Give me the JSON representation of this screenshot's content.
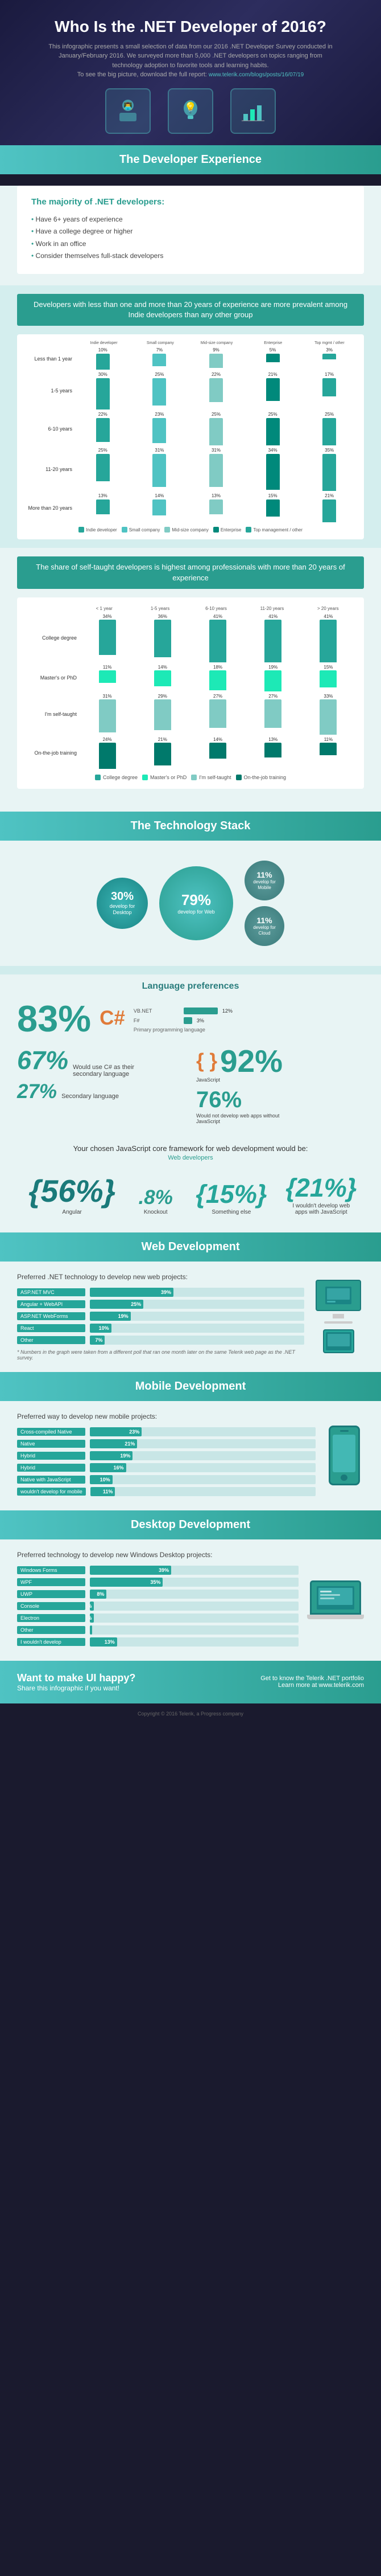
{
  "hero": {
    "title": "Who Is the .NET Developer of 2016?",
    "subtitle": "This infographic presents a small selection of data from our 2016 .NET Developer Survey conducted in January/February 2016. We surveyed more than 5,000 .NET developers on topics ranging from technology adoption to favorite tools and learning habits.",
    "link_text": "www.telerik.com/blogs/posts/16/07/19",
    "link_label": "To see the big picture, download the full report:"
  },
  "sections": {
    "developer_experience": {
      "header": "The Developer Experience",
      "majority_title": "The majority of .NET developers:",
      "majority_items": [
        "Have 6+ years of experience",
        "Have a college degree or higher",
        "Work in an office",
        "Consider themselves full-stack developers"
      ],
      "exp_chart_title": "Developers with less than one and more than 20 years of experience are more prevalent among Indie developers than any other group",
      "experience_rows": [
        {
          "label": "Less than 1 year",
          "values": [
            10,
            7,
            9,
            5,
            3
          ],
          "colors": [
            "#26a69a",
            "#1de9b6",
            "#80cbc4",
            "#4db6ac",
            "#00897b"
          ]
        },
        {
          "label": "1-5 years",
          "values": [
            30,
            25,
            22,
            21,
            17
          ],
          "colors": [
            "#26a69a",
            "#1de9b6",
            "#80cbc4",
            "#4db6ac",
            "#00897b"
          ]
        },
        {
          "label": "6-10 years",
          "values": [
            22,
            23,
            25,
            25,
            25
          ],
          "colors": [
            "#26a69a",
            "#1de9b6",
            "#80cbc4",
            "#4db6ac",
            "#00897b"
          ]
        },
        {
          "label": "11-20 years",
          "values": [
            25,
            31,
            31,
            34,
            35
          ],
          "colors": [
            "#26a69a",
            "#1de9b6",
            "#80cbc4",
            "#4db6ac",
            "#00897b"
          ]
        },
        {
          "label": "More than 20 years",
          "values": [
            13,
            14,
            13,
            15,
            21
          ],
          "colors": [
            "#26a69a",
            "#1de9b6",
            "#80cbc4",
            "#4db6ac",
            "#00897b"
          ]
        }
      ],
      "exp_col_headers": [
        "Indie developer",
        "Small company",
        "Mid-size company",
        "Enterprise",
        "Top management / other"
      ],
      "self_taught_title": "The share of self-taught developers is highest among professionals with more than 20 years of experience",
      "st_labels": [
        "College degree",
        "Master's or PhD",
        "I'm self-taught",
        "On-the-job training"
      ],
      "st_col_headers": [
        "< 1 year",
        "1-5 years",
        "6-10 years",
        "11-20 years",
        "> 20 years"
      ],
      "st_colors": [
        "#26a69a",
        "#1de9b6",
        "#80cbc4",
        "#00796b"
      ],
      "st_data": [
        [
          34,
          36,
          41,
          41,
          41
        ],
        [
          11,
          14,
          18,
          19,
          15
        ],
        [
          31,
          29,
          27,
          27,
          33
        ],
        [
          24,
          21,
          14,
          13,
          11
        ]
      ]
    },
    "tech_stack": {
      "header": "The Technology Stack",
      "bubbles": [
        {
          "pct": "79%",
          "label": "develop for Web",
          "size": "large"
        },
        {
          "pct": "30%",
          "label": "develop for Desktop",
          "size": "medium"
        },
        {
          "pct": "11%",
          "label": "develop for Mobile",
          "size": "small"
        },
        {
          "pct": "11%",
          "label": "develop for Cloud",
          "size": "small"
        }
      ]
    },
    "language_prefs": {
      "header": "Language preferences",
      "c_sharp_pct": "83%",
      "c_sharp_label": "C#",
      "vb_pct": "12%",
      "vb_label": "VB.NET",
      "f_pct": "3%",
      "f_label": "F#",
      "primary_label": "Primary programming language",
      "secondary_pct": "67%",
      "secondary_label": "Would use C# as their secondary language",
      "would_not_use_pct": "27%",
      "would_not_use_label": "Secondary language",
      "script_pct": "92%",
      "script_label": "JavaScript",
      "script_sub": "Would not develop web apps without JavaScript",
      "script_pct2": "76%",
      "script_label2": "Would not develop web apps without JavaScript"
    },
    "js_framework": {
      "title": "Your chosen JavaScript core framework for web development would be:",
      "subtitle": "Web developers",
      "options": [
        {
          "pct": "56%",
          "label": "Angular",
          "size": "large"
        },
        {
          "pct": "8%",
          "label": "Knockout",
          "size": "small"
        },
        {
          "pct": "15%",
          "label": "Something else",
          "size": "medium"
        },
        {
          "pct": "21%",
          "label": "I wouldn't develop web apps with JavaScript",
          "size": "medium"
        }
      ]
    },
    "web_dev": {
      "header": "Web Development",
      "subtitle": "Preferred .NET technology to develop new web projects:",
      "bars": [
        {
          "name": "ASP.NET MVC",
          "pct": 39,
          "color": "#26a69a"
        },
        {
          "name": "Angular + WebAPI",
          "pct": 25,
          "color": "#26a69a"
        },
        {
          "name": "ASP.NET WebForms",
          "pct": 19,
          "color": "#26a69a"
        },
        {
          "name": "React",
          "pct": 10,
          "color": "#26a69a"
        },
        {
          "name": "Other",
          "pct": 7,
          "color": "#26a69a"
        }
      ],
      "note": "* Numbers in the graph were taken from a different poll that ran one month later on the same Telerik web page as the .NET survey."
    },
    "mobile_dev": {
      "header": "Mobile Development",
      "subtitle": "Preferred way to develop new mobile projects:",
      "bars": [
        {
          "name": "Cross-compiled Native",
          "pct": 23,
          "color": "#26a69a"
        },
        {
          "name": "Native",
          "pct": 21,
          "color": "#26a69a"
        },
        {
          "name": "Hybrid",
          "pct": 19,
          "color": "#26a69a"
        },
        {
          "name": "Hybrid",
          "pct": 16,
          "color": "#26a69a"
        },
        {
          "name": "Native with JavaScript",
          "pct": 10,
          "color": "#26a69a"
        },
        {
          "name": "wouldn't develop for mobile",
          "pct": 11,
          "color": "#26a69a"
        }
      ]
    },
    "desktop_dev": {
      "header": "Desktop Development",
      "subtitle": "Preferred technology to develop new Windows Desktop projects:",
      "bars": [
        {
          "name": "Windows Forms",
          "pct": 39,
          "color": "#26a69a"
        },
        {
          "name": "WPF",
          "pct": 35,
          "color": "#26a69a"
        },
        {
          "name": "UWP",
          "pct": 8,
          "color": "#26a69a"
        },
        {
          "name": "Console",
          "pct": 2,
          "color": "#26a69a"
        },
        {
          "name": "Electron",
          "pct": 2,
          "color": "#26a69a"
        },
        {
          "name": "Other",
          "pct": 1,
          "color": "#26a69a"
        },
        {
          "name": "I wouldn't develop",
          "pct": 13,
          "color": "#26a69a"
        }
      ]
    },
    "footer": {
      "cta_title": "Want to make UI happy?",
      "cta_sub": "Share this infographic if you want!",
      "cta_right_line1": "Get to know the Telerik .NET portfolio",
      "cta_right_line2": "Learn more at www.telerik.com",
      "copyright": "Copyright © 2016 Telerik, a Progress company"
    }
  }
}
